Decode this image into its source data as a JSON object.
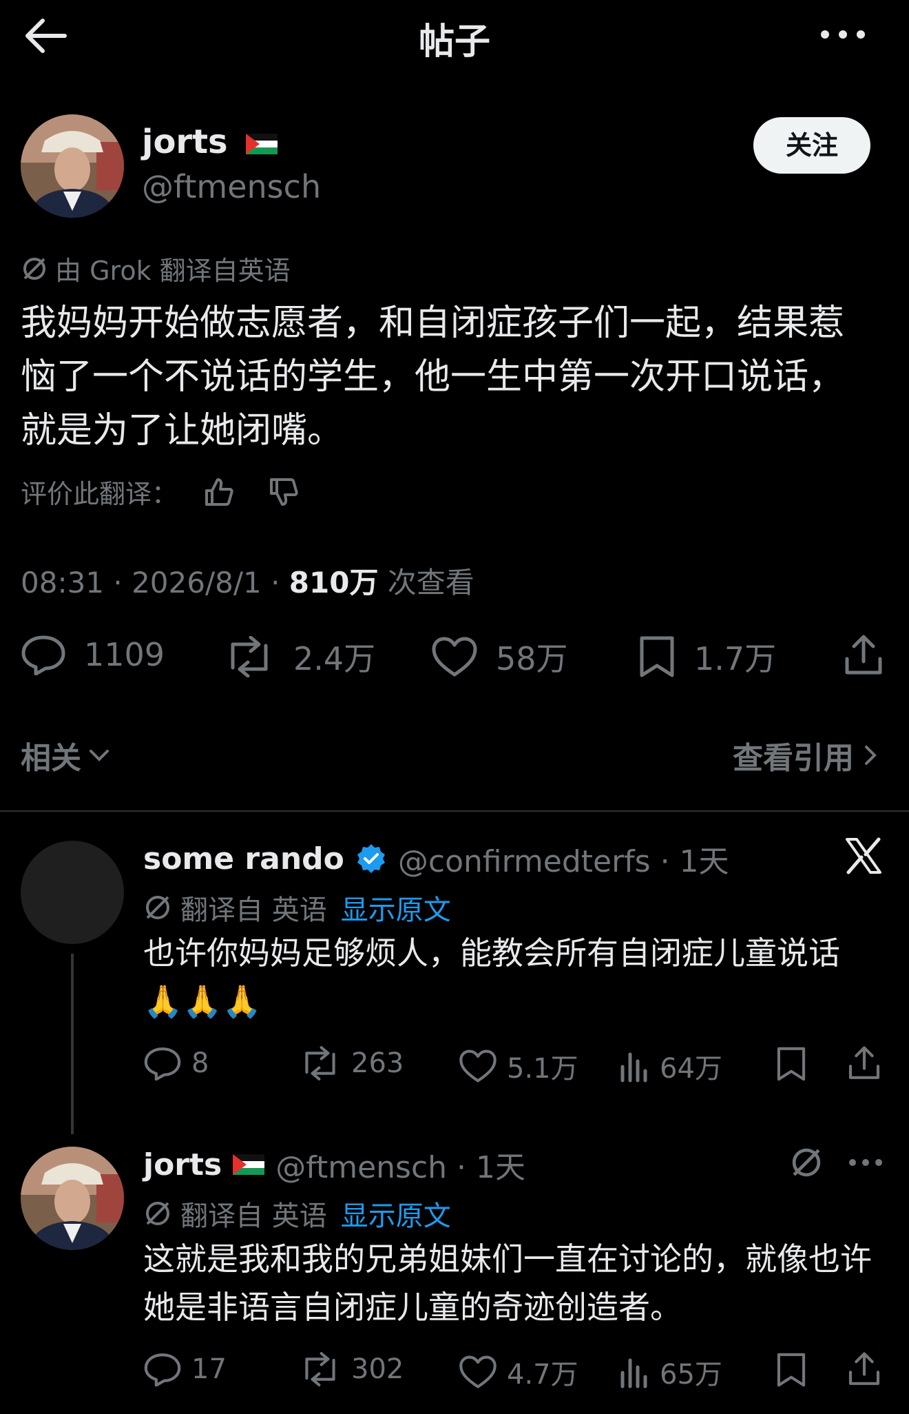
{
  "header": {
    "title": "帖子"
  },
  "post": {
    "author_name": "jorts",
    "author_handle": "@ftmensch",
    "follow_label": "关注",
    "translation_note": "由 Grok 翻译自英语",
    "text": "我妈妈开始做志愿者，和自闭症孩子们一起，结果惹恼了一个不说话的学生，他一生中第一次开口说话，就是为了让她闭嘴。",
    "rate_label": "评价此翻译：",
    "time": "08:31 · 2026/8/1 · ",
    "views": "810万",
    "views_label": " 次查看",
    "replies": "1109",
    "reposts": "2.4万",
    "likes": "58万",
    "bookmarks": "1.7万"
  },
  "related_label": "相关",
  "quotes_label": "查看引用",
  "replies": [
    {
      "name": "some rando",
      "handle_time": "@confirmedterfs · 1天",
      "translation_note": "翻译自 英语",
      "show_original": "显示原文",
      "text": "也许你妈妈足够烦人，能教会所有自闭症儿童说话 🙏🙏🙏",
      "replies": "8",
      "reposts": "263",
      "likes": "5.1万",
      "views": "64万"
    },
    {
      "name": "jorts",
      "handle_time": "@ftmensch · 1天",
      "translation_note": "翻译自 英语",
      "show_original": "显示原文",
      "text": "这就是我和我的兄弟姐妹们一直在讨论的，就像也许她是非语言自闭症儿童的奇迹创造者。",
      "replies": "17",
      "reposts": "302",
      "likes": "4.7万",
      "views": "65万"
    }
  ],
  "colors": {
    "background": "#000000",
    "text": "#e7e9ea",
    "muted": "#71767b",
    "link": "#1d9bf0",
    "verified": "#1d9bf0"
  },
  "icons": [
    "back-arrow-icon",
    "more-icon",
    "palestine-flag-icon",
    "translate-icon",
    "thumbs-up-icon",
    "thumbs-down-icon",
    "reply-icon",
    "repost-icon",
    "like-icon",
    "bookmark-icon",
    "share-icon",
    "views-icon",
    "verified-icon",
    "x-logo-icon",
    "chevron-down-icon",
    "chevron-right-icon"
  ]
}
